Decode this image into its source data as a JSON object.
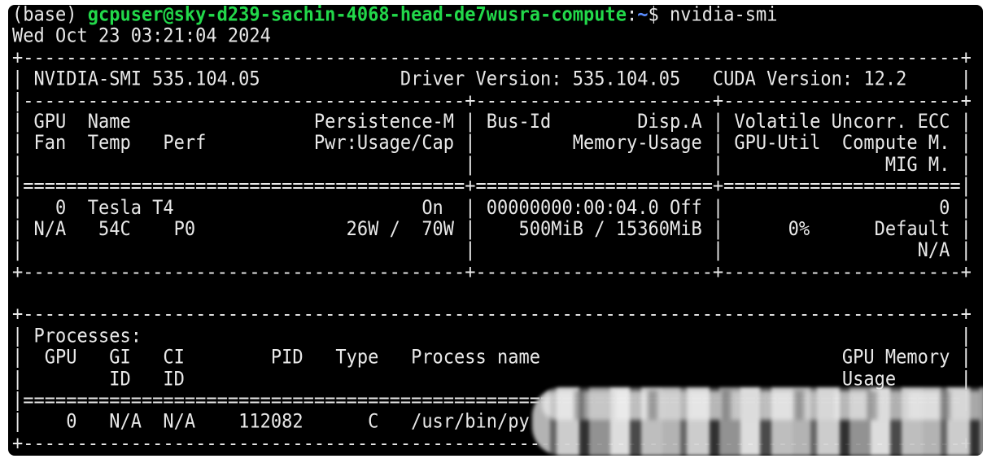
{
  "prompt": {
    "env": "(base) ",
    "user_host": "gcpuser@sky-d239-sachin-4068-head-de7wusra-compute",
    "separator": ":",
    "path": "~",
    "symbol": "$ ",
    "command": "nvidia-smi"
  },
  "timestamp": "Wed Oct 23 03:21:04 2024",
  "output_lines": [
    "+---------------------------------------------------------------------------------------+",
    "| NVIDIA-SMI 535.104.05             Driver Version: 535.104.05   CUDA Version: 12.2     |",
    "|-----------------------------------------+----------------------+----------------------+",
    "| GPU  Name                 Persistence-M | Bus-Id        Disp.A | Volatile Uncorr. ECC |",
    "| Fan  Temp   Perf          Pwr:Usage/Cap |         Memory-Usage | GPU-Util  Compute M. |",
    "|                                         |                      |               MIG M. |",
    "|=========================================+======================+======================|",
    "|   0  Tesla T4                       On  | 00000000:00:04.0 Off |                    0 |",
    "| N/A   54C    P0              26W /  70W |    500MiB / 15360MiB |      0%      Default |",
    "|                                         |                      |                  N/A |",
    "+-----------------------------------------+----------------------+----------------------+",
    "",
    "+---------------------------------------------------------------------------------------+",
    "| Processes:                                                                            |",
    "|  GPU   GI   CI        PID   Type   Process name                            GPU Memory |",
    "|        ID   ID                                                             Usage      |",
    "|=======================================================================================|",
    "|    0   N/A  N/A    112082      C   /usr/bin/py",
    "+---------------------------------------------------------------------------------------+"
  ]
}
